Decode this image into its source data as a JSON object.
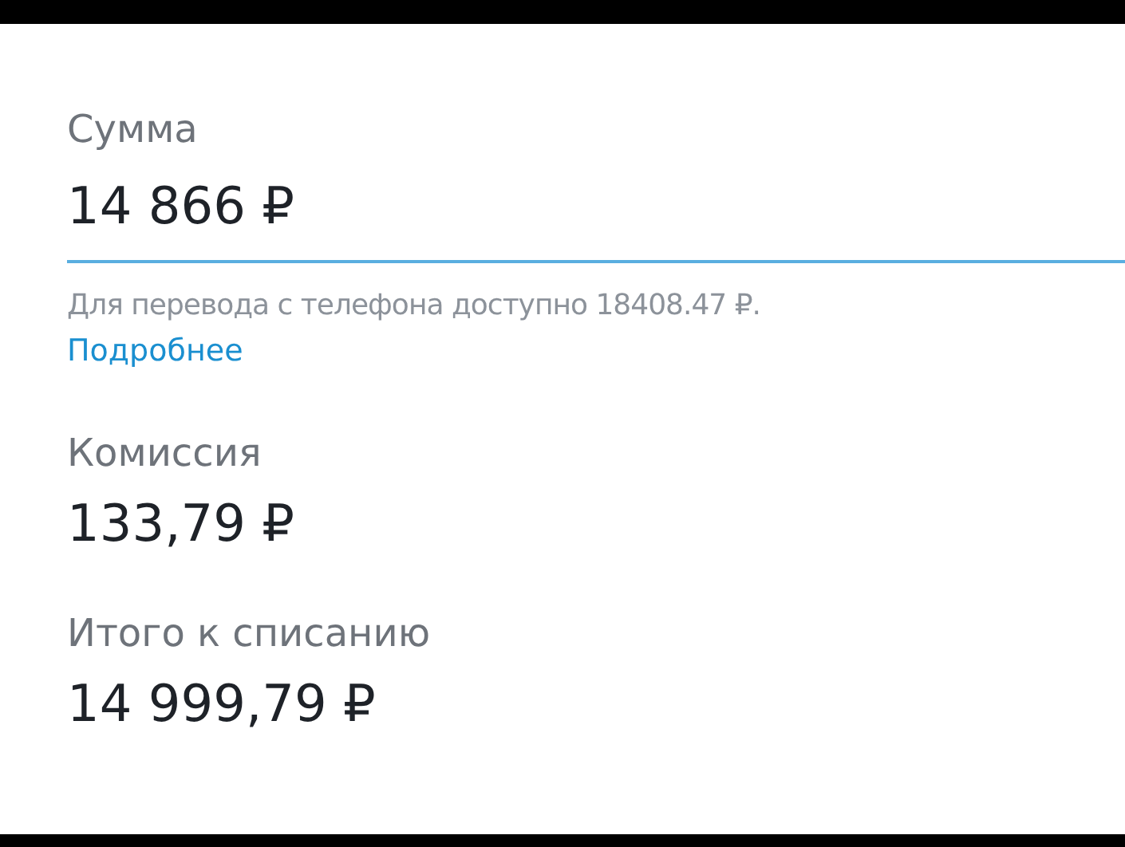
{
  "amount": {
    "label": "Сумма",
    "value": "14 866 ₽"
  },
  "hint": {
    "text": "Для перевода с телефона доступно 18408.47 ₽.",
    "link": "Подробнее"
  },
  "fields": [
    {
      "label": "Комиссия",
      "value": "133,79 ₽"
    },
    {
      "label": "Итого к списанию",
      "value": "14 999,79 ₽"
    }
  ]
}
